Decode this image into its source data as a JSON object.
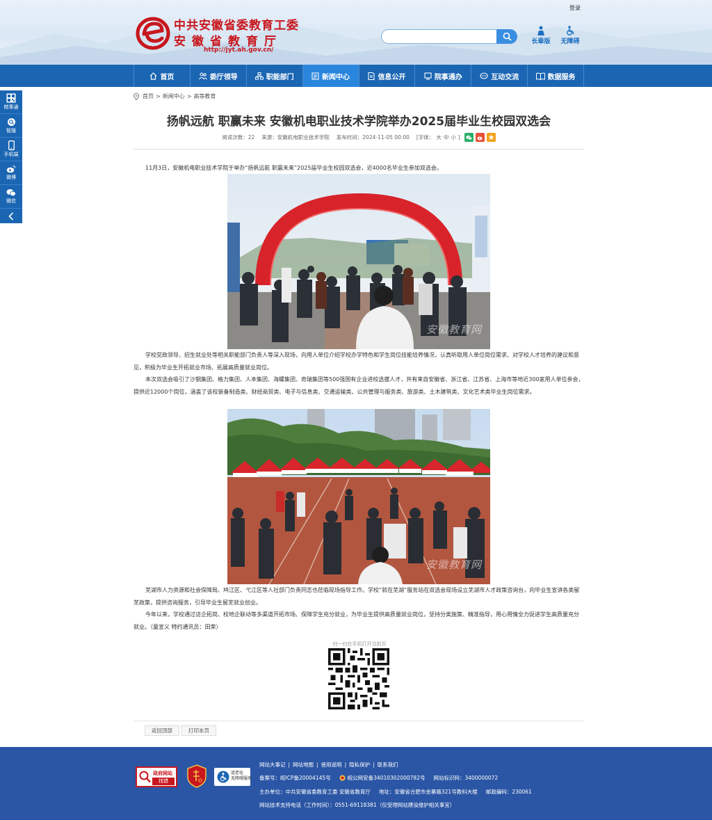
{
  "header": {
    "login_label": "登录",
    "logo_line1": "中共安徽省委教育工委",
    "logo_line2": "安徽省教育厅",
    "logo_url": "http://jyt.ah.gov.cn/",
    "search_placeholder": "",
    "tool_elder": "长辈版",
    "tool_access": "无障碍"
  },
  "nav": [
    {
      "label": "首页",
      "icon": "home-icon"
    },
    {
      "label": "委厅领导",
      "icon": "people-icon"
    },
    {
      "label": "职能部门",
      "icon": "org-icon"
    },
    {
      "label": "新闻中心",
      "icon": "news-icon",
      "active": true
    },
    {
      "label": "信息公开",
      "icon": "doc-icon"
    },
    {
      "label": "院事通办",
      "icon": "service-icon"
    },
    {
      "label": "互动交流",
      "icon": "chat-icon"
    },
    {
      "label": "数据服务",
      "icon": "book-icon"
    }
  ],
  "float_bar": [
    "皖事通",
    "智搜",
    "手机端",
    "微博",
    "微信"
  ],
  "breadcrumb": [
    "首页",
    "新闻中心",
    "高等教育"
  ],
  "article": {
    "title": "扬帆远航 职赢未来 安徽机电职业技术学院举办2025届毕业生校园双选会",
    "views": "阅读次数：22",
    "source": "来源：安徽机电职业技术学院",
    "date": "发布时间：2024-11-05 00:00",
    "font_size_label": "[字体：",
    "font_large": "大",
    "font_medium": "中",
    "font_small": "小",
    "font_close": "]",
    "p1": "11月3日，安徽机电职业技术学院于举办“扬帆远航 职赢未来”2025届毕业生校园双选会，近4000名毕业生参加双选会。",
    "p2": "学校党政领导、招生就业处等相关职能部门负责人等深入现场，向用人单位介绍学校办学特色和学生岗位技能培养情况，认真听取用人单位岗位需求、对学校人才培养的建议和意见，积极为毕业生开拓就业市场、拓展高质量就业岗位。",
    "p3": "本次双选会吸引了沙钢集团、格力集团、人本集团、海螺集团、奇瑞集团等500强国有企业进校选拔人才，共有来自安徽省、浙江省、江苏省、上海市等地近300家用人单位参会，提供近12000个岗位，涵盖了该校装备制造类、财经商贸类、电子与信息类、交通运输类、公共管理与服务类、旅游类、土木建筑类、文化艺术类毕业生岗位需求。",
    "p4": "芜湖市人力资源和社会保障局、鸠江区、弋江区等人社部门负责同志也莅临现场指导工作。学校“就在芜湖”服务站在双选会现场设立芜湖市人才政策咨询台，向毕业生宣讲各类留芜政策，提供咨询服务，引导毕业生留芜就业创业。",
    "p5": "今年以来，学校通过访企拓岗、校地企联动等多渠道开拓市场、保障学生充分就业，为毕业生提供高质量就业岗位，坚持分类施策、精准指导，用心用情全力促进学生高质量充分就业。（童宣义 特约通讯员：田荣）",
    "watermark": "安徽教育网",
    "qr_caption": "扫一扫在手机打开当前页"
  },
  "actions": {
    "back_top": "返回顶部",
    "print": "打印本页"
  },
  "footer": {
    "badge1_top": "政府网站",
    "badge1_bottom": "找错",
    "badge3": "适老化\n无障碍服务",
    "links": [
      "网站大事记",
      "网站地图",
      "使用说明",
      "隐私保护",
      "联系我们"
    ],
    "icp": "备案号：皖ICP备20004145号",
    "police": "皖公网安备34010302000782号",
    "site_code": "网站标识码：3400000072",
    "host": "主办单位：中共安徽省委教育工委 安徽省教育厅",
    "address": "地址：安徽省合肥市金寨路321号教科大楼",
    "zipcode": "邮政编码：230061",
    "support": "网站技术支持电话（工作时间）：0551-69118381（仅受理网站建设维护相关事宜）"
  },
  "colors": {
    "nav_blue": "#1b66b3",
    "nav_active": "#2a86dc",
    "brand_red": "#c8161d",
    "footer_blue": "#2b56a5"
  }
}
